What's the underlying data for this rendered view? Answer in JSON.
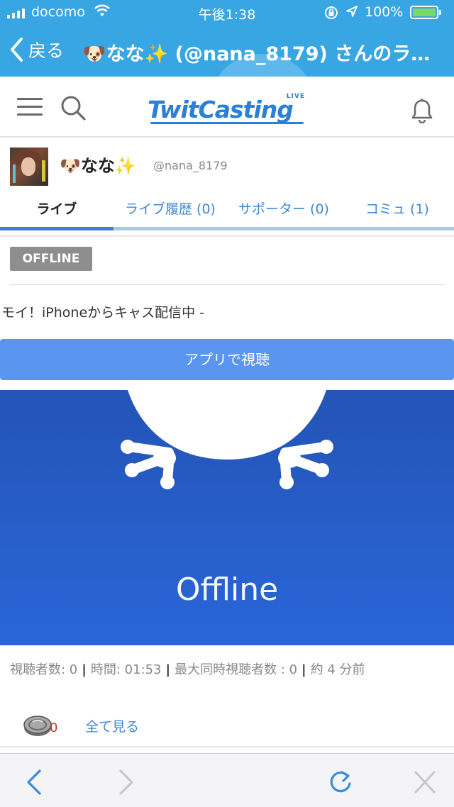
{
  "status_bar": {
    "carrier": "docomo",
    "time": "午後1:38",
    "battery_percent": "100%",
    "battery_level": 1.0
  },
  "nav_bar": {
    "back_label": "戻る",
    "title": "🐶なな✨ (@nana_8179) さんのラ…"
  },
  "header": {
    "logo_text": "TwitCasting",
    "logo_badge": "LIVE",
    "icons": [
      "menu-icon",
      "search-icon",
      "bell-icon"
    ]
  },
  "profile": {
    "name": "🐶なな✨",
    "handle": "@nana_8179"
  },
  "tabs": [
    {
      "label": "ライブ",
      "active": true
    },
    {
      "label": "ライブ履歴 (0)",
      "active": false
    },
    {
      "label": "サポーター (0)",
      "active": false
    },
    {
      "label": "コミュ (1)",
      "active": false
    }
  ],
  "live": {
    "status_badge": "OFFLINE",
    "comment": "モイ！iPhoneからキャス配信中 -",
    "app_button_label": "アプリで視聴",
    "player_text": "Offline"
  },
  "stats": {
    "viewers": "視聴者数: 0",
    "duration": "時間: 01:53",
    "max_viewers": "最大同時視聴者数 : 0",
    "ago": "約 4 分前",
    "separator": "|"
  },
  "supporters": {
    "count": "0",
    "see_all_label": "全て見る"
  },
  "toolbar": {
    "icons": [
      "back-arrow-icon",
      "forward-arrow-icon",
      "reload-icon",
      "close-icon"
    ]
  },
  "colors": {
    "nav_blue": "#39a6e4",
    "brand_blue": "#2a7fd6",
    "button_blue": "#5a95ef",
    "player_blue": "#2a66d8",
    "link_blue": "#3e86d8",
    "badge_gray": "#8e8e8e"
  }
}
